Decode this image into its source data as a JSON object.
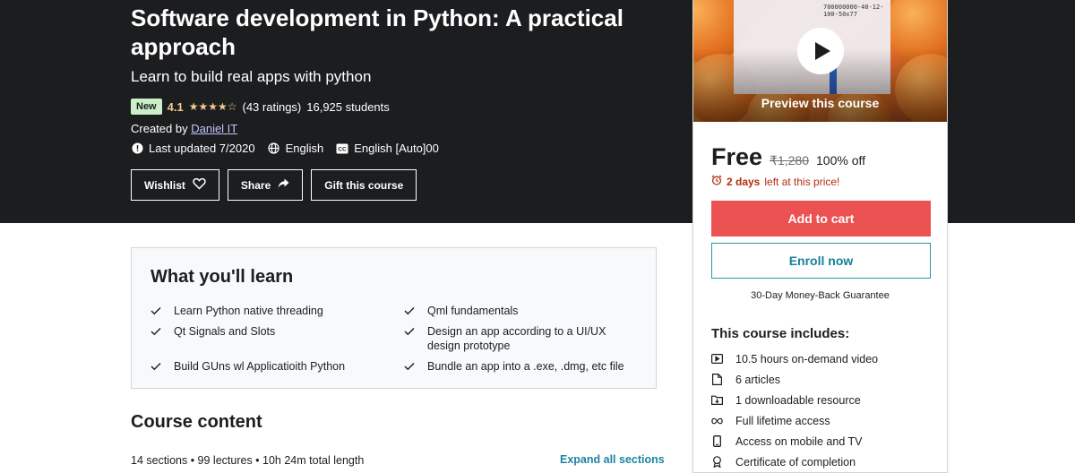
{
  "course": {
    "title": "Software development in Python: A practical approach",
    "subtitle": "Learn to build real apps with python",
    "badge": "New",
    "rating": "4.1",
    "stars": "★★★★☆",
    "ratings_count": "(43 ratings)",
    "students": "16,925 students",
    "created_by_label": "Created by",
    "author": "Daniel IT",
    "last_updated": "Last updated 7/2020",
    "language": "English",
    "captions": "English [Auto]00"
  },
  "actions": {
    "wishlist": "Wishlist",
    "share": "Share",
    "gift": "Gift this course"
  },
  "sidebar": {
    "preview_label": "Preview this course",
    "preview_sheet_text": "700000000-40-12-100-50x77",
    "price": "Free",
    "original_price": "₹1,280",
    "discount": "100% off",
    "deadline_bold": "2 days",
    "deadline_rest": "left at this price!",
    "add_to_cart": "Add to cart",
    "enroll": "Enroll now",
    "guarantee": "30-Day Money-Back Guarantee",
    "includes_title": "This course includes:",
    "includes": [
      {
        "icon": "video-icon",
        "text": "10.5 hours on-demand video"
      },
      {
        "icon": "file-icon",
        "text": "6 articles"
      },
      {
        "icon": "folder-download-icon",
        "text": "1 downloadable resource"
      },
      {
        "icon": "infinity-icon",
        "text": "Full lifetime access"
      },
      {
        "icon": "mobile-icon",
        "text": "Access on mobile and TV"
      },
      {
        "icon": "award-icon",
        "text": "Certificate of completion"
      }
    ]
  },
  "learn": {
    "title": "What you'll learn",
    "items": [
      "Learn Python native threading",
      "Qml fundamentals",
      "Qt Signals and Slots",
      "Design an app according to a UI/UX design prototype",
      "Build GUns wl Applicatioith Python",
      "Bundle an app into a .exe, .dmg, etc file"
    ]
  },
  "content": {
    "title": "Course content",
    "meta": "14 sections • 99 lectures • 10h 24m total length",
    "expand_all": "Expand all sections"
  },
  "colors": {
    "hero_bg": "#1c1d1f",
    "rating_star": "#f3ca8c",
    "cart_button": "#ec5252",
    "deadline": "#b32d0f",
    "link": "#1d84a0"
  }
}
